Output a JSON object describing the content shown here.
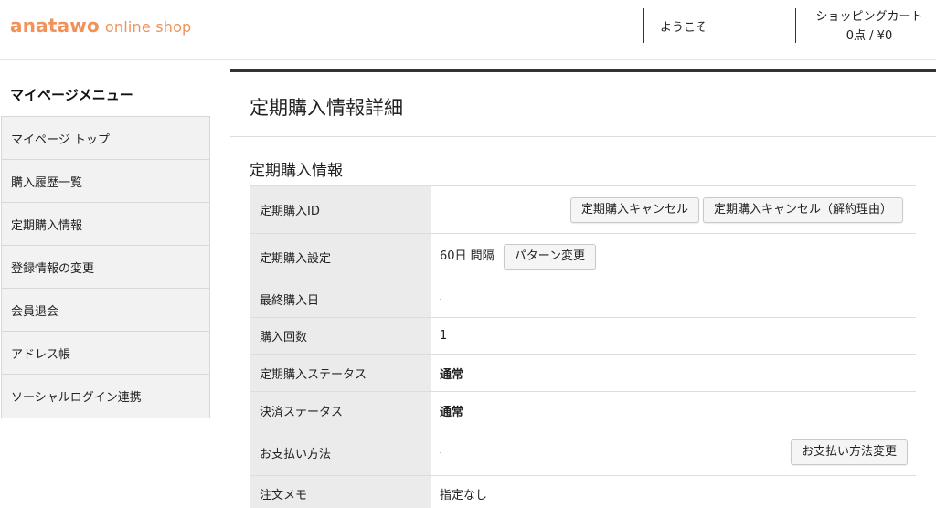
{
  "header": {
    "logo_strong": "anatawo",
    "logo_light": "online shop",
    "welcome": "ようこそ",
    "cart_title": "ショッピングカート",
    "cart_summary": "0点 / ¥0"
  },
  "sidebar": {
    "title": "マイページメニュー",
    "items": [
      {
        "label": "マイページ トップ"
      },
      {
        "label": "購入履歴一覧"
      },
      {
        "label": "定期購入情報"
      },
      {
        "label": "登録情報の変更"
      },
      {
        "label": "会員退会"
      },
      {
        "label": "アドレス帳"
      },
      {
        "label": "ソーシャルログイン連携"
      }
    ]
  },
  "main": {
    "title": "定期購入情報詳細",
    "section_title": "定期購入情報",
    "rows": {
      "id": {
        "label": "定期購入ID",
        "value": ""
      },
      "setting": {
        "label": "定期購入設定",
        "value": "60日 間隔"
      },
      "last_date": {
        "label": "最終購入日",
        "value": ""
      },
      "count": {
        "label": "購入回数",
        "value": "1"
      },
      "status": {
        "label": "定期購入ステータス",
        "value": "通常"
      },
      "payment_status": {
        "label": "決済ステータス",
        "value": "通常"
      },
      "payment_method": {
        "label": "お支払い方法",
        "value": ""
      },
      "memo": {
        "label": "注文メモ",
        "value": "指定なし"
      }
    },
    "buttons": {
      "cancel": "定期購入キャンセル",
      "cancel_reason": "定期購入キャンセル（解約理由）",
      "pattern_change": "パターン変更",
      "payment_change": "お支払い方法変更"
    }
  },
  "colors": {
    "brand": "#f0925a",
    "accent_bar": "#333333",
    "label_bg": "#ebebeb",
    "sidebar_bg": "#f2f2f2"
  }
}
